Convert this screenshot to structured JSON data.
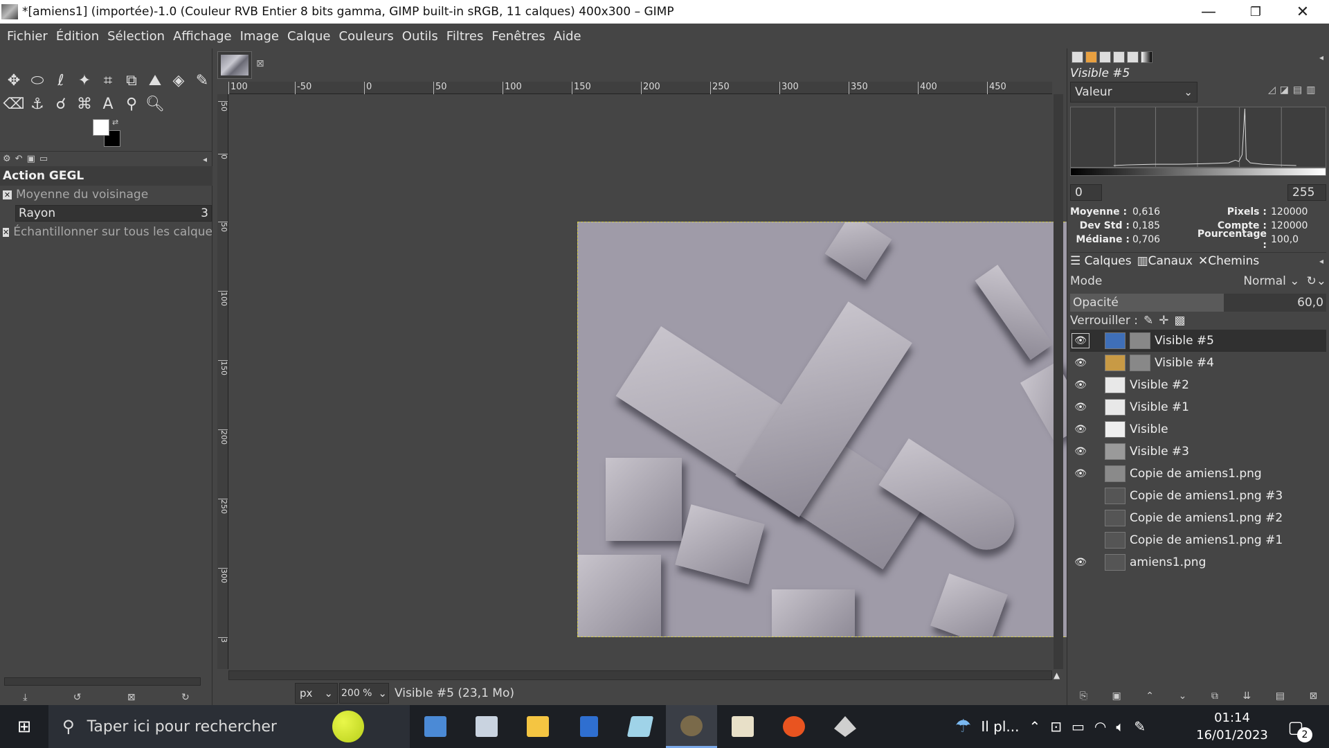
{
  "window": {
    "title": "*[amiens1] (importée)-1.0 (Couleur RVB Entier 8 bits gamma, GIMP built-in sRGB, 11 calques) 400x300 – GIMP",
    "minimize": "—",
    "restore": "❐",
    "close": "✕"
  },
  "menu": [
    "Fichier",
    "Édition",
    "Sélection",
    "Affichage",
    "Image",
    "Calque",
    "Couleurs",
    "Outils",
    "Filtres",
    "Fenêtres",
    "Aide"
  ],
  "tool_options": {
    "title": "Action GEGL",
    "operation": "Moyenne du voisinage",
    "rayon_label": "Rayon",
    "rayon_value": "3",
    "sample_merged": "Échantillonner sur tous les calques"
  },
  "ruler": {
    "h_ticks": [
      "100",
      "-50",
      "0",
      "50",
      "100",
      "150",
      "200",
      "250",
      "300",
      "350",
      "400",
      "450"
    ],
    "v_ticks": [
      "50",
      "0",
      "50",
      "100",
      "150",
      "200",
      "250",
      "300",
      "3"
    ]
  },
  "statusbar": {
    "unit": "px",
    "zoom": "200 %",
    "layer_info": "Visible #5 (23,1 Mo)"
  },
  "histogram": {
    "title": "Visible #5",
    "channel": "Valeur",
    "range_min": "0",
    "range_max": "255",
    "stats": {
      "moyenne_label": "Moyenne :",
      "moyenne": "0,616",
      "devstd_label": "Dev Std :",
      "devstd": "0,185",
      "mediane_label": "Médiane :",
      "mediane": "0,706",
      "pixels_label": "Pixels :",
      "pixels": "120000",
      "compte_label": "Compte :",
      "compte": "120000",
      "pourcentage_label": "Pourcentage :",
      "pourcentage": "100,0"
    }
  },
  "layers_panel": {
    "tabs": [
      "Calques",
      "Canaux",
      "Chemins"
    ],
    "mode_label": "Mode",
    "mode_value": "Normal",
    "opacity_label": "Opacité",
    "opacity_value": "60,0",
    "opacity_fraction": 0.6,
    "lock_label": "Verrouiller :",
    "layers": [
      {
        "name": "Visible #5",
        "visible": true,
        "selected": true,
        "thumb": "#3f6fb8",
        "mask": true
      },
      {
        "name": "Visible #4",
        "visible": true,
        "selected": false,
        "thumb": "#c89a45",
        "mask": true
      },
      {
        "name": "Visible #2",
        "visible": true,
        "selected": false,
        "thumb": "#e8e8e8",
        "mask": false
      },
      {
        "name": "Visible #1",
        "visible": true,
        "selected": false,
        "thumb": "#e8e8e8",
        "mask": false
      },
      {
        "name": "Visible",
        "visible": true,
        "selected": false,
        "thumb": "#eeeeee",
        "mask": false
      },
      {
        "name": "Visible #3",
        "visible": true,
        "selected": false,
        "thumb": "#9a9a9a",
        "mask": false
      },
      {
        "name": "Copie de amiens1.png",
        "visible": true,
        "selected": false,
        "thumb": "#8a8a8a",
        "mask": false
      },
      {
        "name": "Copie de amiens1.png #3",
        "visible": false,
        "selected": false,
        "thumb": "#555555",
        "mask": false
      },
      {
        "name": "Copie de amiens1.png #2",
        "visible": false,
        "selected": false,
        "thumb": "#555555",
        "mask": false
      },
      {
        "name": "Copie de amiens1.png #1",
        "visible": false,
        "selected": false,
        "thumb": "#555555",
        "mask": false
      },
      {
        "name": "amiens1.png",
        "visible": true,
        "selected": false,
        "thumb": "#555555",
        "mask": false
      }
    ]
  },
  "taskbar": {
    "search_placeholder": "Taper ici pour rechercher",
    "weather": "Il pl...",
    "time": "01:14",
    "date": "16/01/2023",
    "notifications": "2"
  }
}
